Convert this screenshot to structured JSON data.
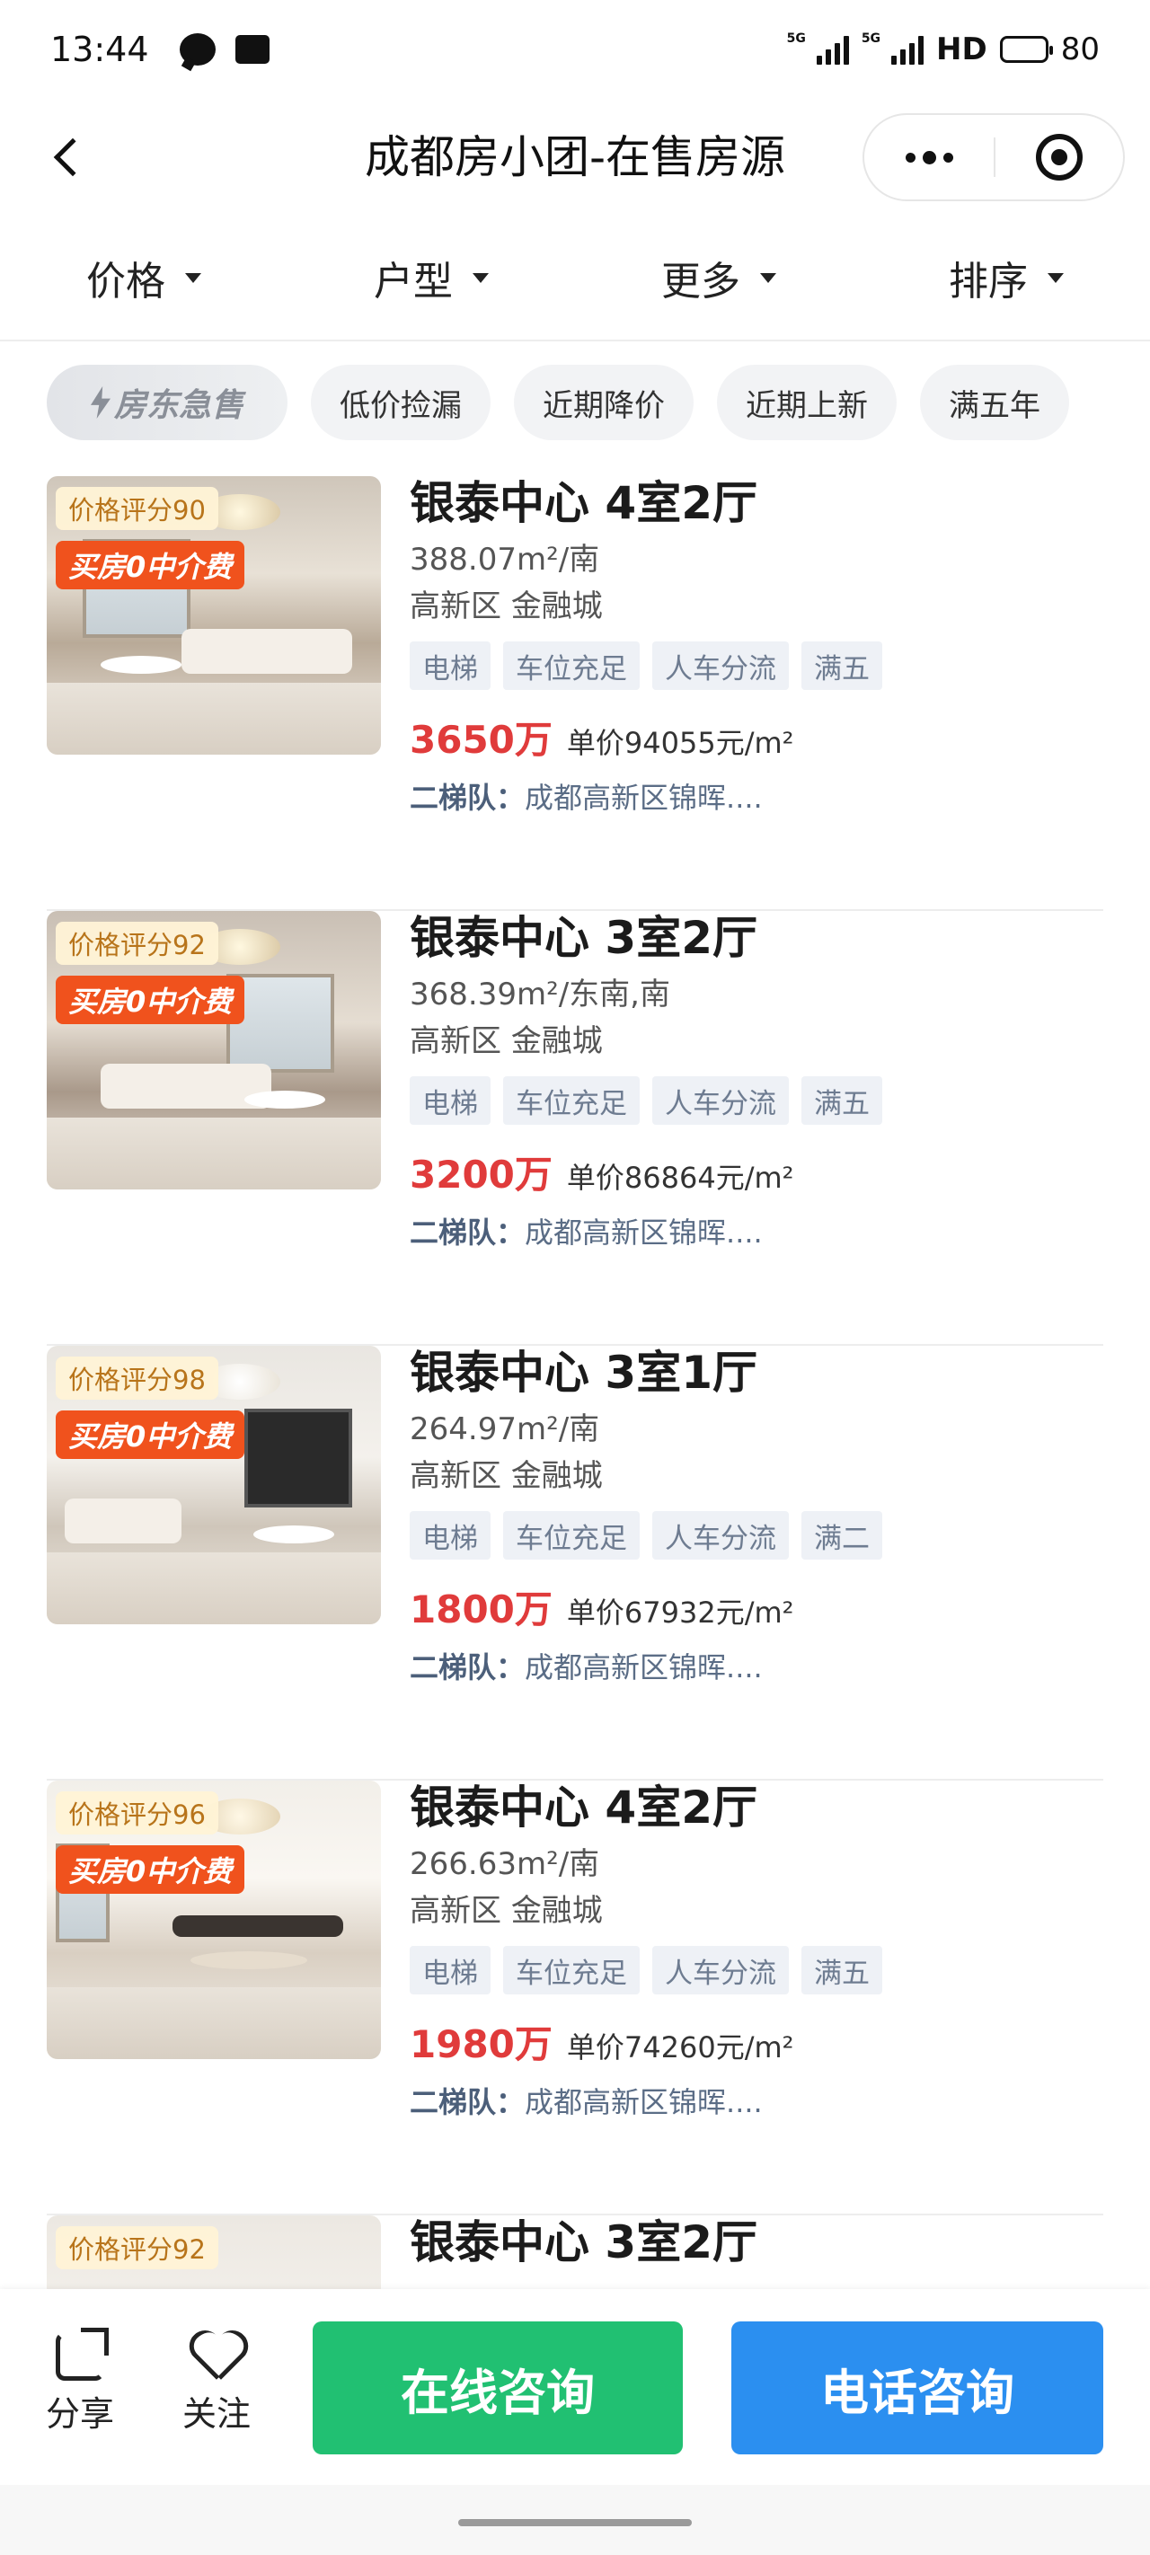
{
  "status_bar": {
    "time": "13:44",
    "network": "5G",
    "hd": "HD",
    "battery": "80"
  },
  "nav": {
    "title": "成都房小团-在售房源"
  },
  "filters": [
    {
      "label": "价格"
    },
    {
      "label": "户型"
    },
    {
      "label": "更多"
    },
    {
      "label": "排序"
    }
  ],
  "chips": {
    "special": "房东急售",
    "items": [
      "低价捡漏",
      "近期降价",
      "近期上新",
      "满五年"
    ]
  },
  "listings": [
    {
      "score": "价格评分90",
      "fee_badge": "买房0中介费",
      "title": "银泰中心 4室2厅",
      "spec": "388.07m²/南",
      "location": "高新区 金融城",
      "tags": [
        "电梯",
        "车位充足",
        "人车分流",
        "满五"
      ],
      "price": "3650万",
      "unit_price": "单价94055元/m²",
      "team_label": "二梯队：",
      "team_text": "成都高新区锦晖...."
    },
    {
      "score": "价格评分92",
      "fee_badge": "买房0中介费",
      "title": "银泰中心 3室2厅",
      "spec": "368.39m²/东南,南",
      "location": "高新区 金融城",
      "tags": [
        "电梯",
        "车位充足",
        "人车分流",
        "满五"
      ],
      "price": "3200万",
      "unit_price": "单价86864元/m²",
      "team_label": "二梯队：",
      "team_text": "成都高新区锦晖...."
    },
    {
      "score": "价格评分98",
      "fee_badge": "买房0中介费",
      "title": "银泰中心 3室1厅",
      "spec": "264.97m²/南",
      "location": "高新区 金融城",
      "tags": [
        "电梯",
        "车位充足",
        "人车分流",
        "满二"
      ],
      "price": "1800万",
      "unit_price": "单价67932元/m²",
      "team_label": "二梯队：",
      "team_text": "成都高新区锦晖...."
    },
    {
      "score": "价格评分96",
      "fee_badge": "买房0中介费",
      "title": "银泰中心 4室2厅",
      "spec": "266.63m²/南",
      "location": "高新区 金融城",
      "tags": [
        "电梯",
        "车位充足",
        "人车分流",
        "满五"
      ],
      "price": "1980万",
      "unit_price": "单价74260元/m²",
      "team_label": "二梯队：",
      "team_text": "成都高新区锦晖...."
    },
    {
      "score": "价格评分92",
      "title": "银泰中心 3室2厅"
    }
  ],
  "bottom_bar": {
    "share_label": "分享",
    "follow_label": "关注",
    "online_label": "在线咨询",
    "phone_label": "电话咨询"
  },
  "colors": {
    "price_red": "#e03b3b",
    "online_green": "#21c072",
    "phone_blue": "#2b8ff0",
    "fee_orange": "#f0521d"
  }
}
